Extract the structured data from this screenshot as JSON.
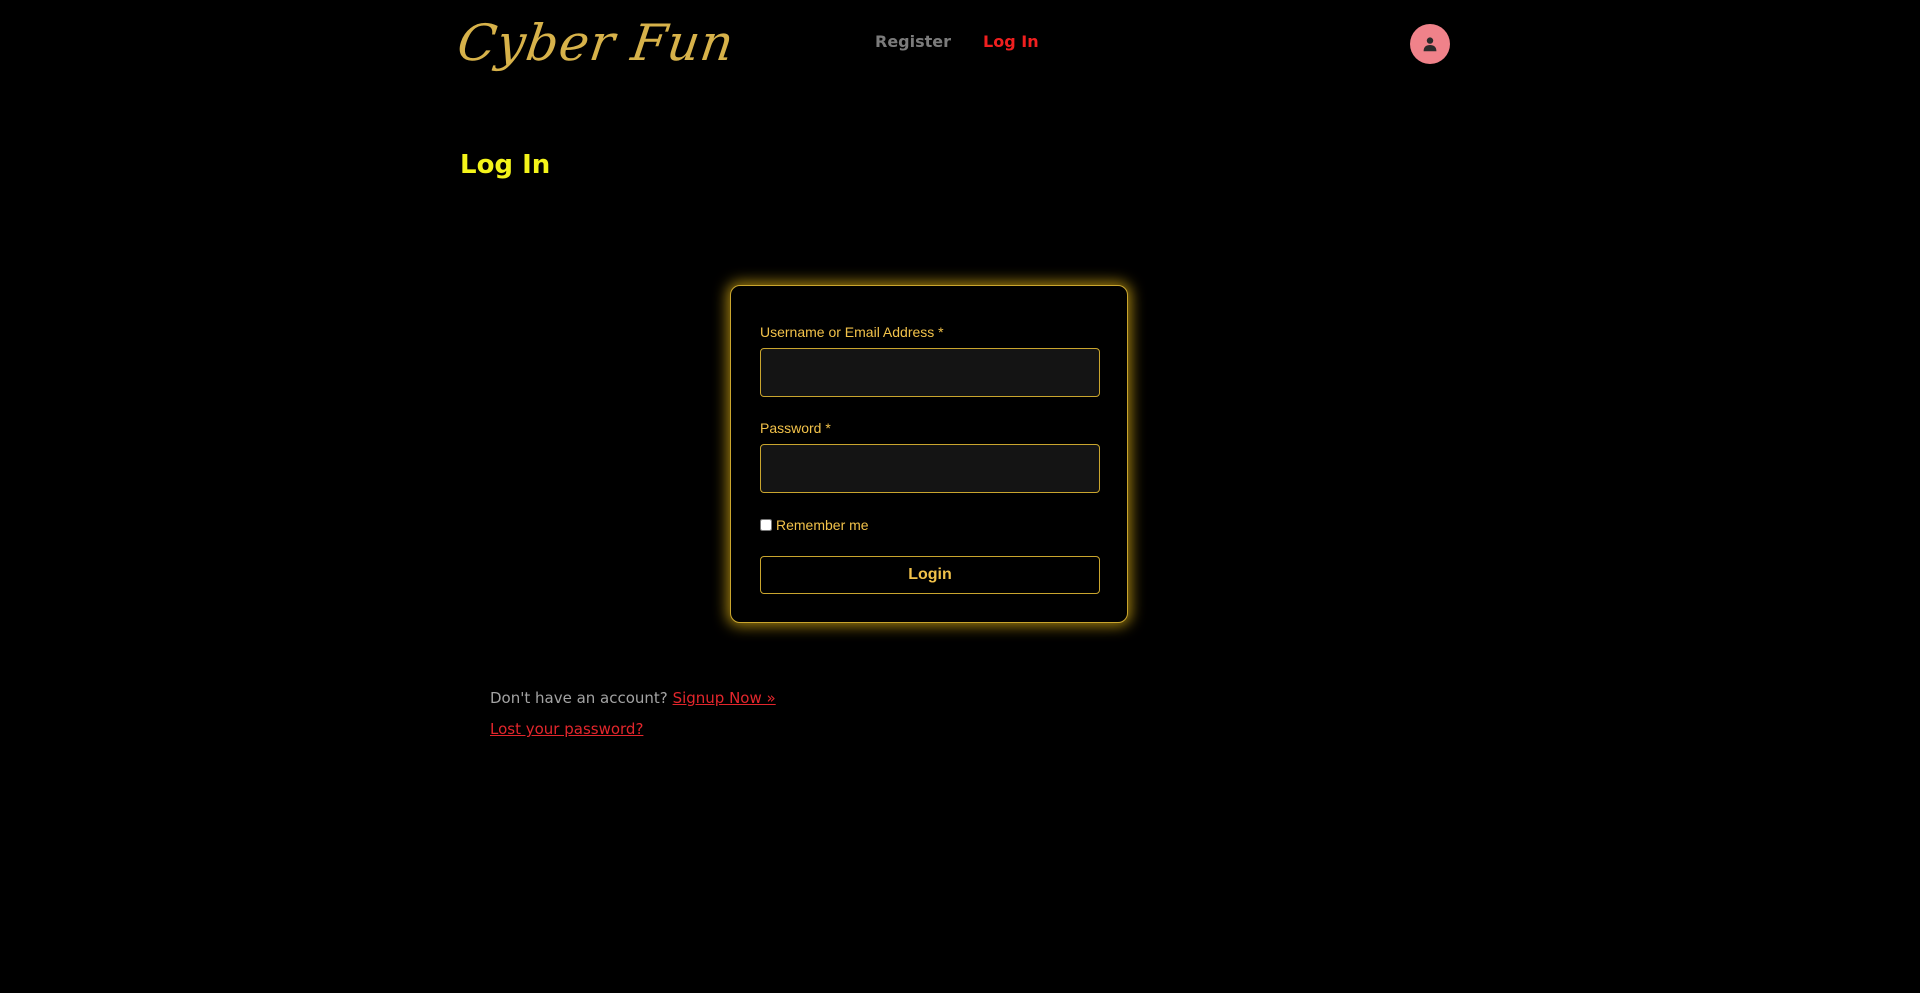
{
  "header": {
    "logo_text": "Cyber Fun",
    "nav": {
      "register_label": "Register",
      "login_label": "Log In"
    },
    "avatar_icon": "user-icon"
  },
  "page_title": "Log In",
  "login_form": {
    "username_label": "Username or Email Address *",
    "username_value": "",
    "password_label": "Password *",
    "password_value": "",
    "remember_label": "Remember me",
    "remember_checked": false,
    "submit_label": "Login"
  },
  "footer_links": {
    "no_account_text": "Don't have an account?",
    "signup_label": "Signup Now »",
    "lost_password_label": "Lost your password?"
  },
  "colors": {
    "background": "#000000",
    "logo_gold": "#d7b24a",
    "title_yellow": "#f4f41a",
    "active_nav_red": "#f01f1f",
    "inactive_nav_gray": "#7b7b7b",
    "form_gold": "#f2c24a",
    "link_red": "#e3262c",
    "avatar_pink": "#f0828a"
  }
}
